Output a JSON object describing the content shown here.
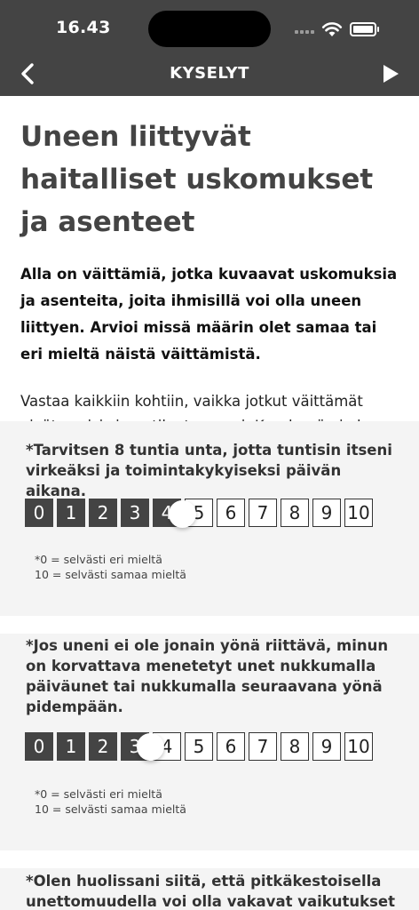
{
  "status_bar": {
    "time": "16.43"
  },
  "nav": {
    "title": "KYSELYT",
    "back_icon": "chevron-left-icon",
    "play_icon": "play-icon"
  },
  "intro": {
    "title": "Uneen liittyvät haitalliset uskomukset ja asenteet",
    "lead": "Alla on väittämiä, jotka kuvaavat uskomuksia ja asenteita, joita ihmisillä voi olla uneen liittyen. Arvioi missä määrin olet samaa tai eri mieltä näistä väittämistä.",
    "instructions": "Vastaa kaikkiin kohtiin, vaikka jotkut väittämät eivät sopisi sinun tilanteeseesi. Kyselyssä ei ole oikeita tai vääriä vastauksia."
  },
  "scale_labels": [
    "0",
    "1",
    "2",
    "3",
    "4",
    "5",
    "6",
    "7",
    "8",
    "9",
    "10"
  ],
  "questions": [
    {
      "text": "*Tarvitsen 8 tuntia unta, jotta tuntisin itseni virkeäksi ja toimintakykyiseksi päivän aikana.",
      "selected_value": 4,
      "legend_low": "*0 = selvästi eri mieltä",
      "legend_high": "10 = selvästi samaa mieltä"
    },
    {
      "text": "*Jos uneni ei ole jonain yönä riittävä, minun on korvattava menetetyt unet nukkumalla päiväunet  tai nukkumalla seuraavana yönä pidempään.",
      "selected_value": 3,
      "legend_low": "*0 = selvästi eri mieltä",
      "legend_high": "10 = selvästi samaa mieltä"
    },
    {
      "text": "*Olen huolissani siitä, että pitkäkestoisella unettomuudella voi olla vakavat vaikutukset"
    }
  ],
  "colors": {
    "header": "#444444",
    "card": "#f4f4f4",
    "filled_cell": "#444444"
  }
}
